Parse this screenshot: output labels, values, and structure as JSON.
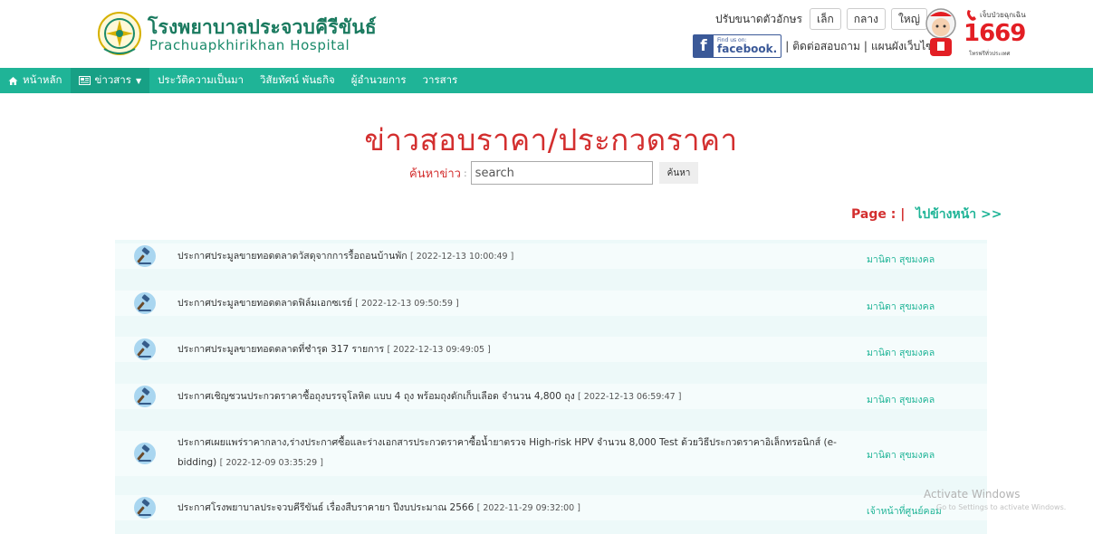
{
  "header": {
    "hospital_name_th": "โรงพยาบาลประจวบคีรีขันธ์",
    "hospital_name_en": "Prachuapkhirikhan Hospital",
    "font_size": {
      "label": "ปรับขนาดตัวอักษร",
      "small": "เล็ก",
      "medium": "กลาง",
      "large": "ใหญ่"
    },
    "facebook": {
      "small_text": "Find us on:",
      "big_text": "facebook."
    },
    "links": [
      "ติดต่อสอบถาม",
      "แผนผังเว็บไซต์"
    ],
    "emergency": {
      "top_text": "เจ็บป่วยฉุกเฉิน",
      "number": "1669",
      "bottom_text": "โทรฟรีทั่วประเทศ"
    }
  },
  "nav": {
    "items": [
      {
        "label": "หน้าหลัก",
        "icon": "home-icon"
      },
      {
        "label": "ข่าวสาร",
        "icon": "newspaper-icon"
      },
      {
        "label": "ประวัติความเป็นมา"
      },
      {
        "label": "วิสัยทัศน์ พันธกิจ"
      },
      {
        "label": "ผู้อำนวยการ"
      },
      {
        "label": "วารสาร"
      }
    ]
  },
  "page": {
    "title": "ข่าวสอบราคา/ประกวดราคา",
    "search": {
      "label": "ค้นหาข่าว",
      "colon": ":",
      "placeholder": "search",
      "button": "ค้นหา"
    },
    "pager": {
      "label": "Page : |",
      "next": "ไปข้างหน้า >>"
    }
  },
  "news": [
    {
      "title": "ประกาศประมูลขายทอดตลาดวัสดุจากการรื้อถอนบ้านพัก",
      "date": "[ 2022-12-13 10:00:49 ]",
      "author": "มานิดา สุขมงคล"
    },
    {
      "title": "ประกาศประมูลขายทอดตลาดฟิล์มเอกซเรย์",
      "date": "[ 2022-12-13 09:50:59 ]",
      "author": "มานิดา สุขมงคล"
    },
    {
      "title": "ประกาศประมูลขายทอดตลาดที่ชำรุด 317 รายการ",
      "date": "[ 2022-12-13 09:49:05 ]",
      "author": "มานิดา สุขมงคล"
    },
    {
      "title": "ประกาศเชิญชวนประกวดราคาซื้อถุงบรรจุโลหิต แบบ 4 ถุง พร้อมถุงดักเก็บเลือด จำนวน 4,800 ถุง",
      "date": "[ 2022-12-13 06:59:47 ]",
      "author": "มานิดา สุขมงคล"
    },
    {
      "title": "ประกาศเผยแพร่ราคากลาง,ร่างประกาศซื้อและร่างเอกสารประกวดราคาซื้อน้ำยาตรวจ High-risk HPV จำนวน 8,000 Test ด้วยวิธีประกวดราคาอิเล็กทรอนิกส์ (e-bidding)",
      "date": "[ 2022-12-09 03:35:29 ]",
      "author": "มานิดา สุขมงคล"
    },
    {
      "title": "ประกาศโรงพยาบาลประจวบคีรีขันธ์ เรื่องสืบราคายา ปีงบประมาณ 2566",
      "date": "[ 2022-11-29 09:32:00 ]",
      "author": "เจ้าหน้าที่ศูนย์คอม"
    }
  ],
  "watermark": {
    "line1": "Activate Windows",
    "line2": "Go to Settings to activate Windows."
  }
}
